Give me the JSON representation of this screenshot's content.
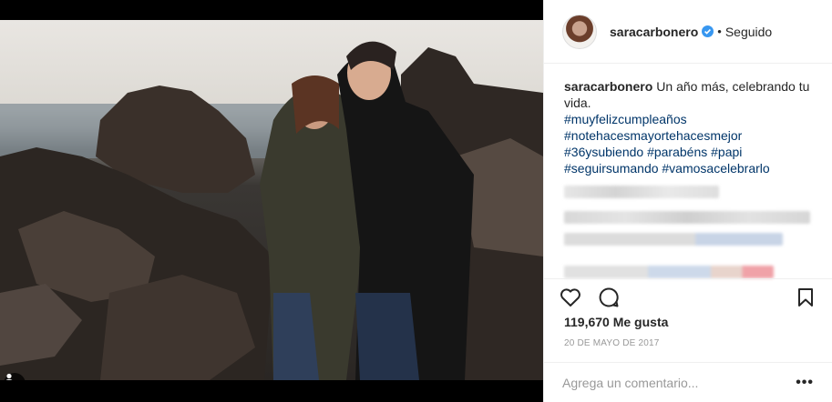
{
  "post": {
    "username": "saracarbonero",
    "verified": true,
    "separator": "•",
    "follow_status": "Seguido",
    "caption_text": "Un año más, celebrando tu vida.",
    "hashtags": [
      "#muyfelizcumpleaños",
      "#notehacesmayortehacesmejor",
      "#36ysubiendo #parabéns #papi",
      "#seguirsumando #vamosacelebrarlo"
    ],
    "likes": "119,670 Me gusta",
    "date": "20 DE MAYO DE 2017",
    "comment_placeholder": "Agrega un comentario...",
    "more_options": "•••"
  },
  "colors": {
    "link": "#003569",
    "verified": "#3897f0",
    "border": "#efefef",
    "muted": "#999999"
  },
  "icons": [
    "heart-icon",
    "comment-icon",
    "bookmark-icon",
    "user-tag-icon",
    "verified-badge-icon",
    "more-options-icon"
  ]
}
